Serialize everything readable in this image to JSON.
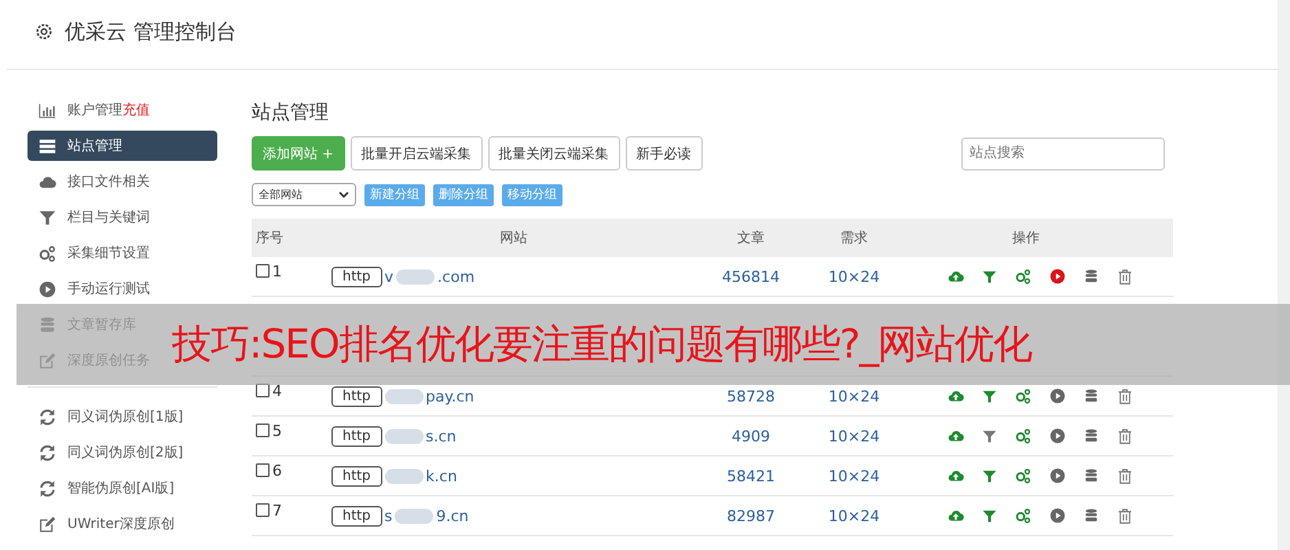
{
  "header": {
    "title": "优采云 管理控制台"
  },
  "sidebar": {
    "items": [
      {
        "label": "账户管理",
        "badge": "充值",
        "kind": "chart",
        "selected": false
      },
      {
        "label": "站点管理",
        "kind": "list",
        "selected": true
      },
      {
        "label": "接口文件相关",
        "kind": "cloud",
        "selected": false
      },
      {
        "label": "栏目与关键词",
        "kind": "filter",
        "selected": false
      },
      {
        "label": "采集细节设置",
        "kind": "gears",
        "selected": false
      },
      {
        "label": "手动运行测试",
        "kind": "play",
        "selected": false
      },
      {
        "label": "文章暂存库",
        "kind": "db",
        "selected": false
      },
      {
        "label": "深度原创任务",
        "kind": "edit",
        "selected": false,
        "divider_after": true
      },
      {
        "label": "同义词伪原创[1版]",
        "kind": "sync",
        "selected": false
      },
      {
        "label": "同义词伪原创[2版]",
        "kind": "sync",
        "selected": false
      },
      {
        "label": "智能伪原创[AI版]",
        "kind": "sync",
        "selected": false
      },
      {
        "label": "UWriter深度原创",
        "kind": "edit",
        "selected": false
      }
    ]
  },
  "main": {
    "title": "站点管理",
    "buttons": [
      {
        "label": "添加网站 +",
        "kind": "primary"
      },
      {
        "label": "批量开启云端采集",
        "kind": "default"
      },
      {
        "label": "批量关闭云端采集",
        "kind": "default"
      },
      {
        "label": "新手必读",
        "kind": "default"
      }
    ],
    "search": {
      "placeholder": "站点搜索"
    },
    "group_select": {
      "value": "全部网站"
    },
    "group_buttons": [
      "新建分组",
      "删除分组",
      "移动分组"
    ],
    "table": {
      "columns": [
        "序号",
        "网站",
        "文章",
        "需求",
        "操作"
      ],
      "rows": [
        {
          "no": "1",
          "checked": false,
          "scheme": "http",
          "url_start": "v",
          "url_end": ".com",
          "articles": "456814",
          "demand": "10×24",
          "filter": true,
          "running": true
        },
        {
          "no": "4",
          "checked": false,
          "scheme": "http",
          "url_start": "",
          "url_end": "pay.cn",
          "articles": "58728",
          "demand": "10×24",
          "filter": true,
          "running": false
        },
        {
          "no": "5",
          "checked": false,
          "scheme": "http",
          "url_start": "",
          "url_end": "s.cn",
          "articles": "4909",
          "demand": "10×24",
          "filter": false,
          "running": false
        },
        {
          "no": "6",
          "checked": false,
          "scheme": "http",
          "url_start": "",
          "url_end": "k.cn",
          "articles": "58421",
          "demand": "10×24",
          "filter": true,
          "running": false
        },
        {
          "no": "7",
          "checked": false,
          "scheme": "http",
          "url_start": "s",
          "url_end": "9.cn",
          "articles": "82987",
          "demand": "10×24",
          "filter": true,
          "running": false
        }
      ]
    }
  },
  "banner": {
    "text": "技巧:SEO排名优化要注重的问题有哪些?_网站优化"
  }
}
